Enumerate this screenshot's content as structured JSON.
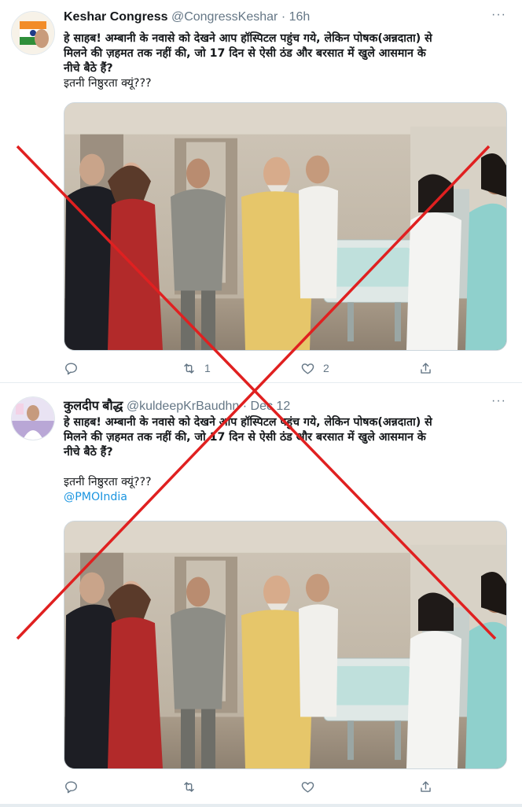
{
  "tweets": [
    {
      "author_name": "Keshar Congress",
      "handle": "@CongressKeshar",
      "separator": "·",
      "time": "16h",
      "text_line1": "हे साहब! अम्बानी के नवासे को देखने आप हॉस्पिटल पहुंच गये, लेकिन पोषक(अन्नदाता) से",
      "text_line2": "मिलने की ज़हमत तक नहीं की, जो 17 दिन से ऐसी ठंड और बरसात में खुले आसमान के",
      "text_line3": "नीचे बैठे हैं?",
      "text_line4": "इतनी निष्ठुरता क्यूं???",
      "more_label": "···",
      "reply_count": "",
      "retweet_count": "1",
      "like_count": "2"
    },
    {
      "author_name": "कुलदीप बौद्ध",
      "handle": "@kuldeepKrBaudhn",
      "separator": "·",
      "time": "Dec 12",
      "text_line1": "हे साहब! अम्बानी के नवासे को देखने आप हॉस्पिटल पहुंच गये, लेकिन पोषक(अन्नदाता) से",
      "text_line2": "मिलने की ज़हमत तक नहीं की, जो 17 दिन से ऐसी ठंड और बरसात में खुले आसमान के",
      "text_line3": "नीचे बैठे हैं?",
      "text_line4": "इतनी निष्ठुरता क्यूं???",
      "mention": "@PMOIndia",
      "more_label": "···",
      "reply_count": "",
      "retweet_count": "",
      "like_count": ""
    }
  ],
  "icons": {
    "reply": "reply-icon",
    "retweet": "retweet-icon",
    "like": "heart-icon",
    "share": "share-icon",
    "more": "more-options-icon"
  },
  "colors": {
    "cross_mark": "#e02020",
    "link": "#1b95e0",
    "secondary_text": "#657786"
  }
}
